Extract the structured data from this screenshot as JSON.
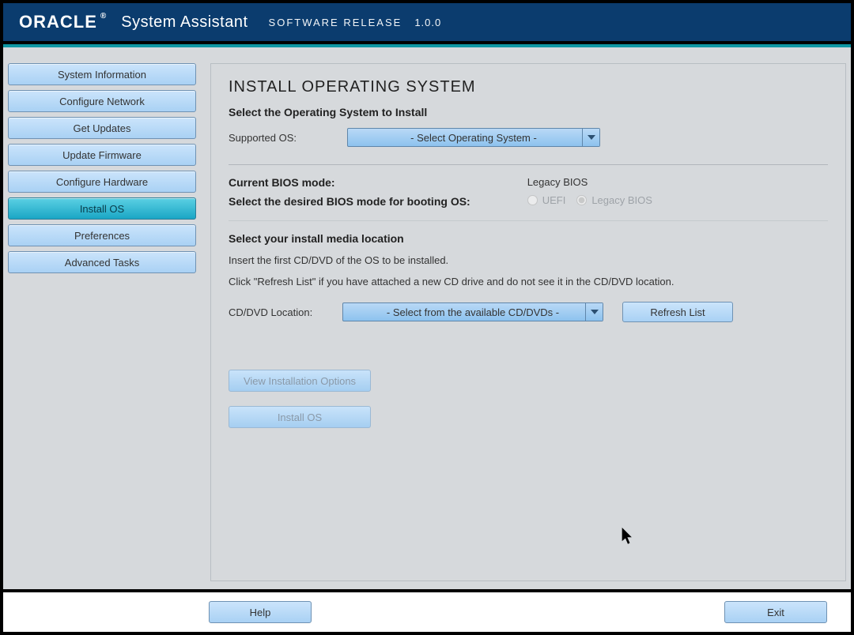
{
  "header": {
    "brand": "ORACLE",
    "reg": "®",
    "title": "System Assistant",
    "release_label": "SOFTWARE RELEASE",
    "release_version": "1.0.0"
  },
  "sidebar": {
    "items": [
      {
        "label": "System Information"
      },
      {
        "label": "Configure Network"
      },
      {
        "label": "Get Updates"
      },
      {
        "label": "Update Firmware"
      },
      {
        "label": "Configure Hardware"
      },
      {
        "label": "Install OS"
      },
      {
        "label": "Preferences"
      },
      {
        "label": "Advanced Tasks"
      }
    ],
    "active_index": 5
  },
  "main": {
    "title": "INSTALL OPERATING SYSTEM",
    "select_os_title": "Select the Operating System to Install",
    "supported_os_label": "Supported OS:",
    "supported_os_value": "- Select Operating System -",
    "bios": {
      "current_label": "Current BIOS mode:",
      "current_value": "Legacy BIOS",
      "select_label": "Select the desired BIOS mode for booting OS:",
      "option_uefi": "UEFI",
      "option_legacy": "Legacy BIOS"
    },
    "media": {
      "title": "Select your install media location",
      "insert_text": "Insert the first CD/DVD of the OS to be installed.",
      "refresh_hint": "Click \"Refresh List\" if you have attached a new CD drive and do not see it in the CD/DVD location.",
      "location_label": "CD/DVD Location:",
      "location_value": "- Select from the available CD/DVDs -",
      "refresh_button": "Refresh List"
    },
    "buttons": {
      "view_options": "View Installation Options",
      "install": "Install OS"
    }
  },
  "footer": {
    "help": "Help",
    "exit": "Exit"
  }
}
